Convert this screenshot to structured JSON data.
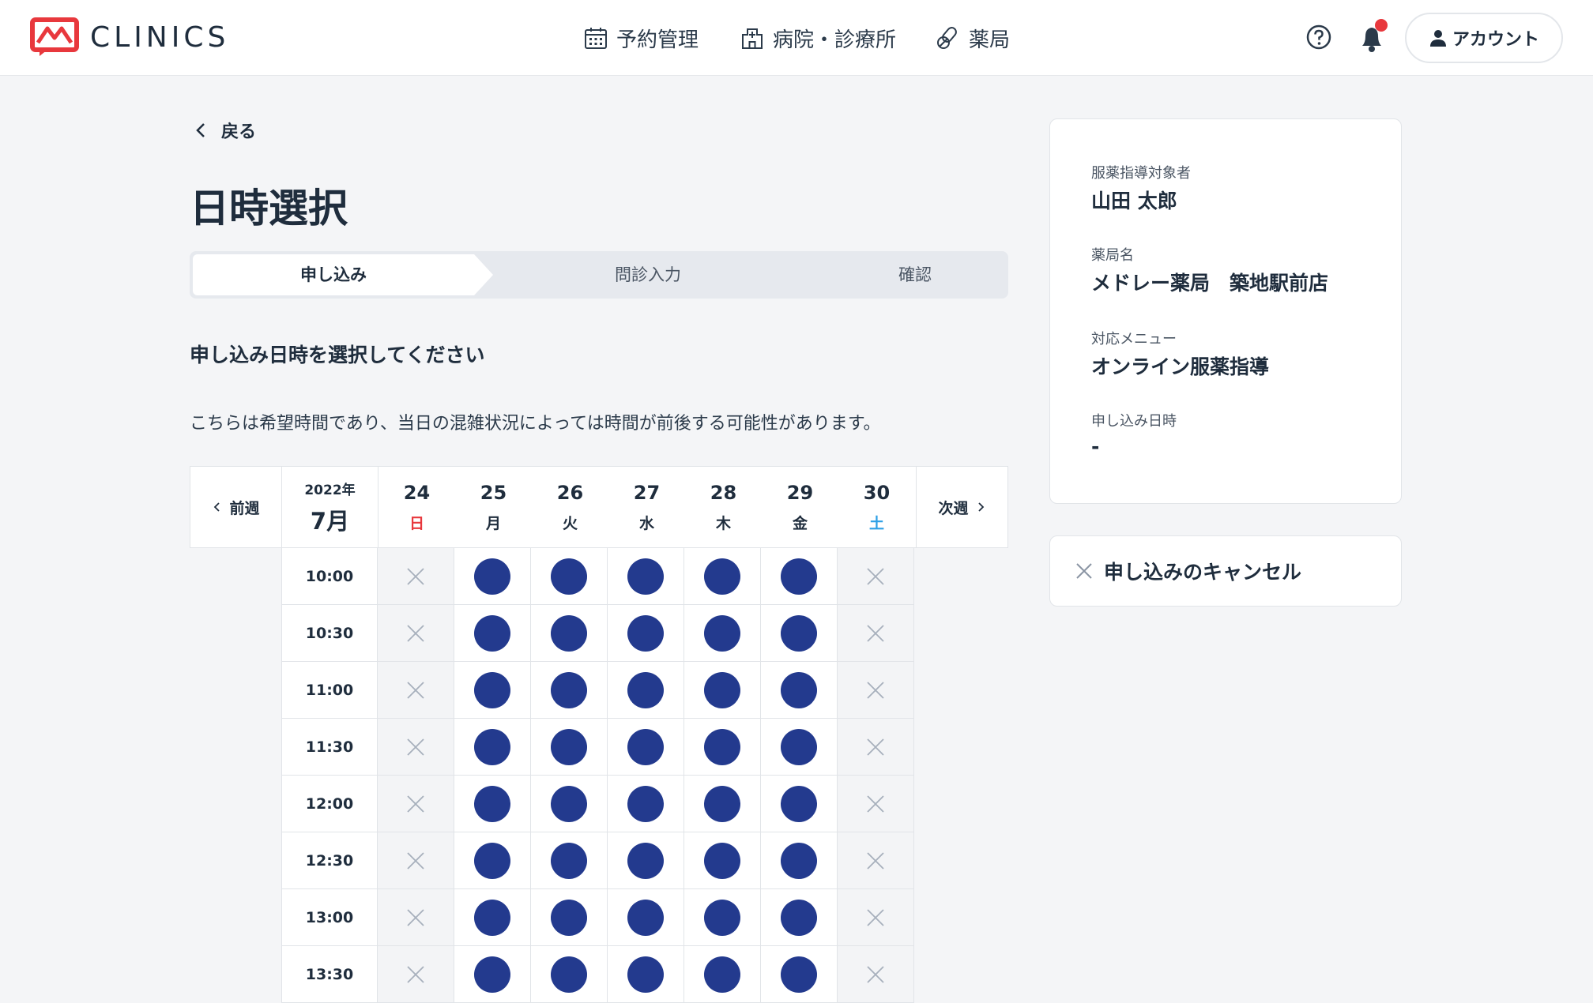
{
  "header": {
    "logo_text": "CLINICS",
    "nav": [
      {
        "label": "予約管理",
        "icon": "calendar-icon"
      },
      {
        "label": "病院・診療所",
        "icon": "hospital-icon"
      },
      {
        "label": "薬局",
        "icon": "pills-icon"
      }
    ],
    "account_label": "アカウント",
    "has_notification": true
  },
  "back_label": "戻る",
  "page_title": "日時選択",
  "stepper": [
    "申し込み",
    "問診入力",
    "確認"
  ],
  "active_step": 0,
  "section_title": "申し込み日時を選択してください",
  "notice": "こちらは希望時間であり、当日の混雑状況によっては時間が前後する可能性があります。",
  "calendar": {
    "prev_label": "前週",
    "next_label": "次週",
    "year": "2022年",
    "month": "7月",
    "days": [
      {
        "num": "24",
        "weekday": "日",
        "type": "sun"
      },
      {
        "num": "25",
        "weekday": "月",
        "type": ""
      },
      {
        "num": "26",
        "weekday": "火",
        "type": ""
      },
      {
        "num": "27",
        "weekday": "水",
        "type": ""
      },
      {
        "num": "28",
        "weekday": "木",
        "type": ""
      },
      {
        "num": "29",
        "weekday": "金",
        "type": ""
      },
      {
        "num": "30",
        "weekday": "土",
        "type": "sat"
      }
    ],
    "times": [
      "10:00",
      "10:30",
      "11:00",
      "11:30",
      "12:00",
      "12:30",
      "13:00",
      "13:30"
    ],
    "availability": [
      false,
      true,
      true,
      true,
      true,
      true,
      false
    ]
  },
  "sidebar": {
    "patient_label": "服薬指導対象者",
    "patient_value": "山田 太郎",
    "pharmacy_label": "薬局名",
    "pharmacy_value": "メドレー薬局　築地駅前店",
    "menu_label": "対応メニュー",
    "menu_value": "オンライン服薬指導",
    "datetime_label": "申し込み日時",
    "datetime_value": "-"
  },
  "cancel_label": "申し込みのキャンセル",
  "colors": {
    "accent": "#233a8e",
    "brand_red": "#e8383d",
    "saturday": "#2ea0e6"
  }
}
